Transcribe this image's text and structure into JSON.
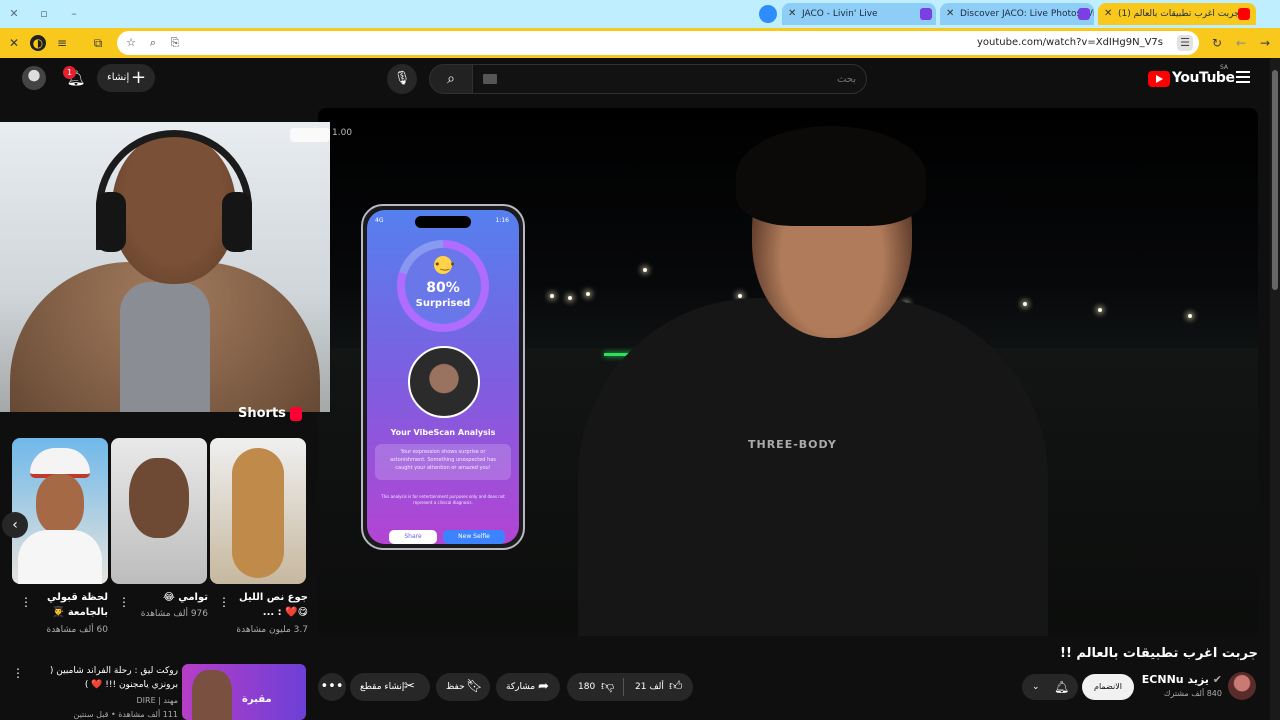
{
  "browser": {
    "tabs": [
      {
        "title": "JACO - Livin' Live"
      },
      {
        "title": "Discover JACO: Live Photos, Vid"
      },
      {
        "title": "(1) جربت اغرب تطبيقات بالعالم !!"
      }
    ],
    "url": "youtube.com/watch?v=XdIHg9N_V7s"
  },
  "header": {
    "notification_count": "1",
    "create_label": "إنشاء",
    "search_placeholder": "بحث",
    "logo_text": "YouTube",
    "region": "SA"
  },
  "player": {
    "time_overlay": "1.00",
    "shirt_text": "THREE-BODY",
    "phone": {
      "status_left": "4G",
      "status_right": "1:16",
      "percent": "80%",
      "emotion": "Surprised",
      "analysis_title": "Your VibeScan Analysis",
      "analysis_text": "Your expression shows surprise or astonishment. Something unexpected has caught your attention or amazed you!",
      "disclaimer": "This analysis is for entertainment purposes only and does not represent a clinical diagnosis.",
      "share_label": "Share",
      "new_selfie_label": "New Selfie"
    }
  },
  "shorts": {
    "title": "Shorts",
    "items": [
      {
        "title": "جوع نص الليل 😋❤️ : ...",
        "views": "3.7 مليون مشاهدة"
      },
      {
        "title": "توامي 😂",
        "views": "976 ألف مشاهدة"
      },
      {
        "title": "لحظة قبولي بالجامعة 👨‍🎓",
        "views": "60 ألف مشاهدة"
      }
    ]
  },
  "recommended": {
    "title": "روكت ليق : رحلة الفراند شامبين ( برونزي يامجنون !!! ❤️ )",
    "channel": "مهند | DIRE",
    "views": "111 ألف مشاهدة • قبل سنتين",
    "thumb_text": "مقبرة"
  },
  "video": {
    "title": "جربت اغرب تطبيقات بالعالم !!",
    "channel": "يزيد ECNNu",
    "subscribers": "840 ألف مشترك",
    "join_label": "الانضمام",
    "likes": "21 ألف",
    "dislikes": "180",
    "share_label": "مشاركة",
    "save_label": "حفظ",
    "clip_label": "إنشاء مقطع"
  }
}
